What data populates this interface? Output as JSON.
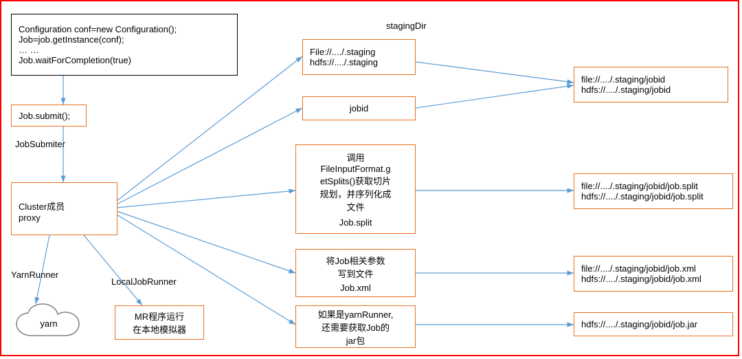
{
  "codeBox": {
    "l1": "Configuration conf=new Configuration();",
    "l2": "Job=job.getInstance(conf);",
    "l3": "… …",
    "l4": "Job.waitForCompletion(true)"
  },
  "jobSubmit": "Job.submit();",
  "jobSubmiterLabel": "JobSubmiter",
  "clusterProxy": {
    "l1": "Cluster成员",
    "l2": "proxy"
  },
  "yarnRunnerLabel": "YarnRunner",
  "localJobRunnerLabel": "LocalJobRunner",
  "yarnCloud": "yarn",
  "mrLocal": {
    "l1": "MR程序运行",
    "l2": "在本地模拟器"
  },
  "stagingDirLabel": "stagingDir",
  "stagingBox": {
    "l1": "File://..../.staging",
    "l2": "hdfs://..../.staging"
  },
  "jobidBox": "jobid",
  "splitsBox": {
    "l1": "调用",
    "l2": "FileInputFormat.g",
    "l3": "etSplits()获取切片",
    "l4": "规划，并序列化成",
    "l5": "文件",
    "l6": "Job.split"
  },
  "xmlBox": {
    "l1": "将Job相关参数",
    "l2": "写到文件",
    "l3": "Job.xml"
  },
  "jarBox": {
    "l1": "如果是yarnRunner,",
    "l2": "还需要获取Job的",
    "l3": "jar包"
  },
  "out1": {
    "l1": "file://..../.staging/jobid",
    "l2": "hdfs://..../.staging/jobid"
  },
  "out2": {
    "l1": "file://..../.staging/jobid/job.split",
    "l2": "hdfs://..../.staging/jobid/job.split"
  },
  "out3": {
    "l1": "file://..../.staging/jobid/job.xml",
    "l2": "hdfs://..../.staging/jobid/job.xml"
  },
  "out4": {
    "l1": "hdfs://..../.staging/jobid/job.jar"
  }
}
